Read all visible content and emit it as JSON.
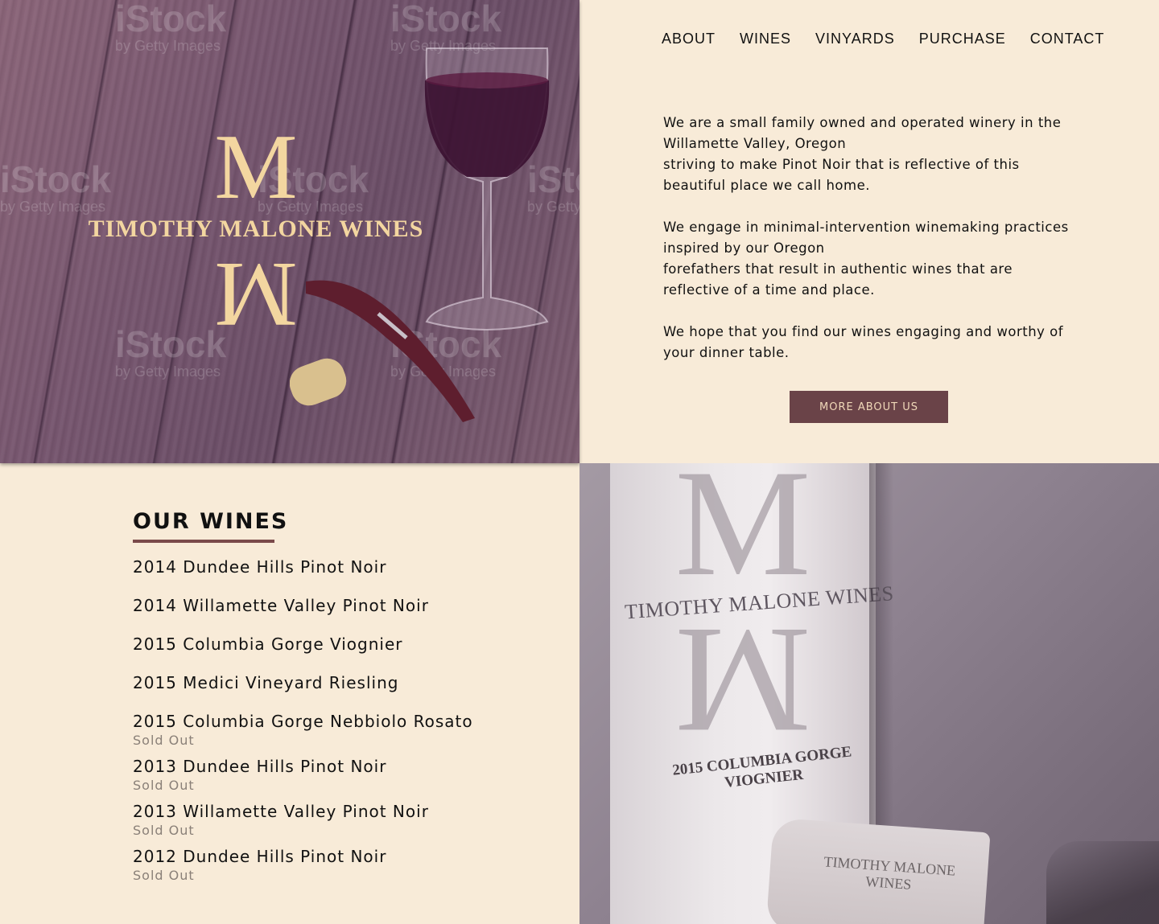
{
  "hero": {
    "logo_text": "TIMOTHY MALONE WINES",
    "logo_letter": "M",
    "watermark_brand": "iStock",
    "watermark_sub": "by Getty Images"
  },
  "nav": {
    "items": [
      {
        "label": "ABOUT"
      },
      {
        "label": "WINES"
      },
      {
        "label": "VINYARDS"
      },
      {
        "label": "PURCHASE"
      },
      {
        "label": "CONTACT"
      }
    ]
  },
  "about": {
    "paragraphs": [
      {
        "line1": "We are a small family owned and operated winery in the",
        "line2": "Willamette Valley, Oregon",
        "line3": "striving to make Pinot Noir that is reflective of this",
        "line4": "beautiful place we call home."
      },
      {
        "line1": "We engage in minimal-intervention winemaking practices",
        "line2": "inspired by our Oregon",
        "line3": "forefathers that result in authentic wines that are",
        "line4": "reflective of a time and place."
      },
      {
        "line1": "We hope that you find our wines engaging and worthy of",
        "line2": "your dinner table."
      }
    ],
    "button_label": "MORE ABOUT US"
  },
  "wines": {
    "title": "OUR WINES",
    "available": [
      {
        "name": "2014 Dundee Hills Pinot Noir"
      },
      {
        "name": "2014 Willamette Valley Pinot Noir"
      },
      {
        "name": "2015 Columbia Gorge Viognier"
      },
      {
        "name": "2015 Medici Vineyard Riesling"
      }
    ],
    "sold_out": [
      {
        "name": "2015 Columbia Gorge Nebbiolo Rosato",
        "status": "Sold Out"
      },
      {
        "name": "2013 Dundee Hills Pinot Noir",
        "status": "Sold Out"
      },
      {
        "name": "2013 Willamette Valley Pinot Noir",
        "status": "Sold Out"
      },
      {
        "name": "2012 Dundee Hills Pinot Noir",
        "status": "Sold Out"
      }
    ]
  },
  "bottle_photo": {
    "label_letter": "M",
    "label_name": "TIMOTHY MALONE WINES",
    "label_vintage_line1": "2015 COLUMBIA GORGE",
    "label_vintage_line2": "VIOGNIER",
    "cork_text": "TIMOTHY MALONE WINES"
  },
  "colors": {
    "background": "#f8ebd8",
    "accent": "#6a4348",
    "logo_gold": "#f3d6a0",
    "sold_out_gray": "#8a8078"
  }
}
